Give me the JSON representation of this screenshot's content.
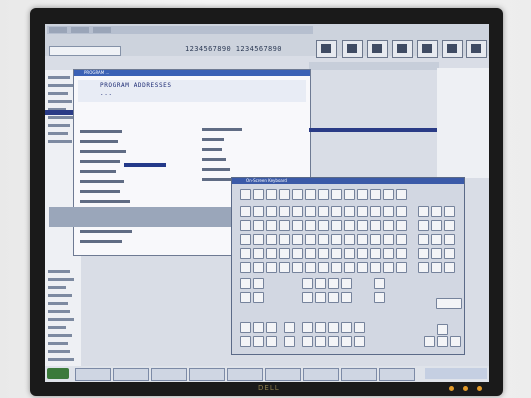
{
  "monitor": {
    "brand": "DELL"
  },
  "app": {
    "title": "PROGRAM ...",
    "header_line1": "PROGRAM ADDRESSES",
    "header_line2": "..."
  },
  "toolbar_readout": "1234567890 1234567890",
  "keyboard": {
    "title": "On-Screen Keyboard"
  },
  "colors": {
    "bezel": "#1a1a1a",
    "screen_bg": "#d9dde6",
    "selection": "#2a3b86",
    "title_bar": "#3b61b5",
    "led": "#e29a2a"
  },
  "icons": [
    "toolbar-icon",
    "toolbar-icon",
    "toolbar-icon",
    "toolbar-icon",
    "toolbar-icon",
    "toolbar-icon",
    "toolbar-icon",
    "toolbar-icon"
  ]
}
